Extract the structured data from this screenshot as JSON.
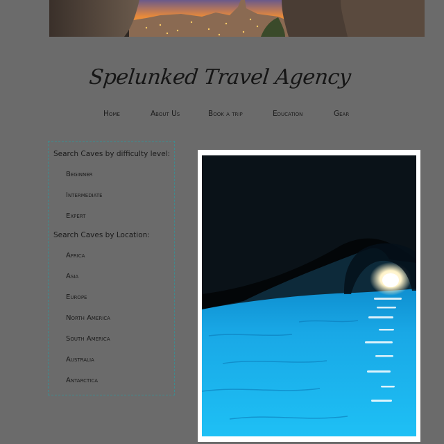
{
  "site": {
    "title": "Spelunked Travel Agency"
  },
  "nav": {
    "items": [
      {
        "id": "home",
        "label": "Home"
      },
      {
        "id": "about",
        "label": "About Us"
      },
      {
        "id": "book",
        "label": "Book a trip"
      },
      {
        "id": "education",
        "label": "Education"
      },
      {
        "id": "gear",
        "label": "Gear"
      }
    ]
  },
  "sidebar": {
    "difficulty_heading": "Search Caves by difficulty level:",
    "difficulty": [
      "Beginner",
      "Intermediate",
      "Expert"
    ],
    "location_heading": "Search Caves by Location:",
    "locations": [
      "Africa",
      "Asia",
      "Europe",
      "North America",
      "South America",
      "Australia",
      "Antarctica"
    ]
  },
  "colors": {
    "page_bg": "#6b6b6b",
    "sidebar_border": "#3e8b8f",
    "text": "#1b1b1b",
    "water": "#19a8e6"
  },
  "images": {
    "banner": "cave-view-of-hilltop-town-at-sunset",
    "main": "blue-grotto-sea-cave"
  }
}
